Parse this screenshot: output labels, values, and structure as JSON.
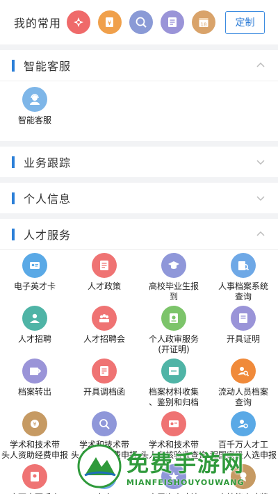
{
  "favorites": {
    "label": "我的常用",
    "custom_button": "定制",
    "icons": [
      {
        "name": "talent-card-favorite-icon",
        "color": "#ef6a6a"
      },
      {
        "name": "money-favorite-icon",
        "color": "#f0a04b"
      },
      {
        "name": "search-favorite-icon",
        "color": "#8a9ad6"
      },
      {
        "name": "form-favorite-icon",
        "color": "#9a94d8"
      },
      {
        "name": "calendar-favorite-icon",
        "color": "#d9a36a",
        "text": "18"
      }
    ]
  },
  "sections": {
    "smart_service": {
      "title": "智能客服",
      "item": {
        "label": "智能客服",
        "icon": "agent-icon",
        "color": "#7eb6e8"
      }
    },
    "business_tracking": {
      "title": "业务跟踪"
    },
    "personal_info": {
      "title": "个人信息"
    },
    "talent_service": {
      "title": "人才服务",
      "items": [
        {
          "label": "电子英才卡",
          "icon": "id-card-icon",
          "color": "#5aa9e6"
        },
        {
          "label": "人才政策",
          "icon": "policy-icon",
          "color": "#ef7373"
        },
        {
          "label": "高校毕业生报\n到",
          "icon": "graduate-icon",
          "color": "#8f97d9"
        },
        {
          "label": "人事档案系统\n查询",
          "icon": "archive-search-icon",
          "color": "#6ea8e6"
        },
        {
          "label": "人才招聘",
          "icon": "recruit-icon",
          "color": "#4fb4a6"
        },
        {
          "label": "人才招聘会",
          "icon": "job-fair-icon",
          "color": "#ef7373"
        },
        {
          "label": "个人政审服务\n(开证明)",
          "icon": "certificate-icon",
          "color": "#7cc46a"
        },
        {
          "label": "开具证明",
          "icon": "document-icon",
          "color": "#9a94d8"
        },
        {
          "label": "档案转出",
          "icon": "transfer-icon",
          "color": "#9a94d8"
        },
        {
          "label": "开具调档函",
          "icon": "letter-icon",
          "color": "#ef7373"
        },
        {
          "label": "档案材料收集\n、鉴别和归档",
          "icon": "file-collect-icon",
          "color": "#4fb4a6"
        },
        {
          "label": "流动人员档案\n查询",
          "icon": "person-search-icon",
          "color": "#f08a3a"
        },
        {
          "label": "学术和技术带\n头人资助经费申报",
          "icon": "funding-icon",
          "color": "#c69a63"
        },
        {
          "label": "学术和技术带\n头人资助经费申报",
          "icon": "funding-search-icon",
          "color": "#8f97d9"
        },
        {
          "label": "学术和技术带\n头人考核验收查询",
          "icon": "assessment-icon",
          "color": "#ef7373"
        },
        {
          "label": "百千万人才工\n程国家级人选申报",
          "icon": "talent-search-icon",
          "color": "#5aa9e6"
        },
        {
          "label": "广西十百千人\n才工程第二层次人",
          "icon": "talent-level-icon",
          "color": "#ef7373"
        },
        {
          "label": "专家\n申报查询",
          "icon": "expert-icon",
          "color": "#6ea8e6"
        },
        {
          "label": "高层次人才认\n定申请",
          "icon": "high-talent-icon",
          "color": "#8f97d9"
        },
        {
          "label": "高技能人才奖\n励",
          "icon": "skill-award-icon",
          "color": "#c69a63"
        }
      ]
    }
  },
  "watermark": {
    "cn": "免费手游网",
    "en": "MIANFEISHOUYOUWANG"
  }
}
